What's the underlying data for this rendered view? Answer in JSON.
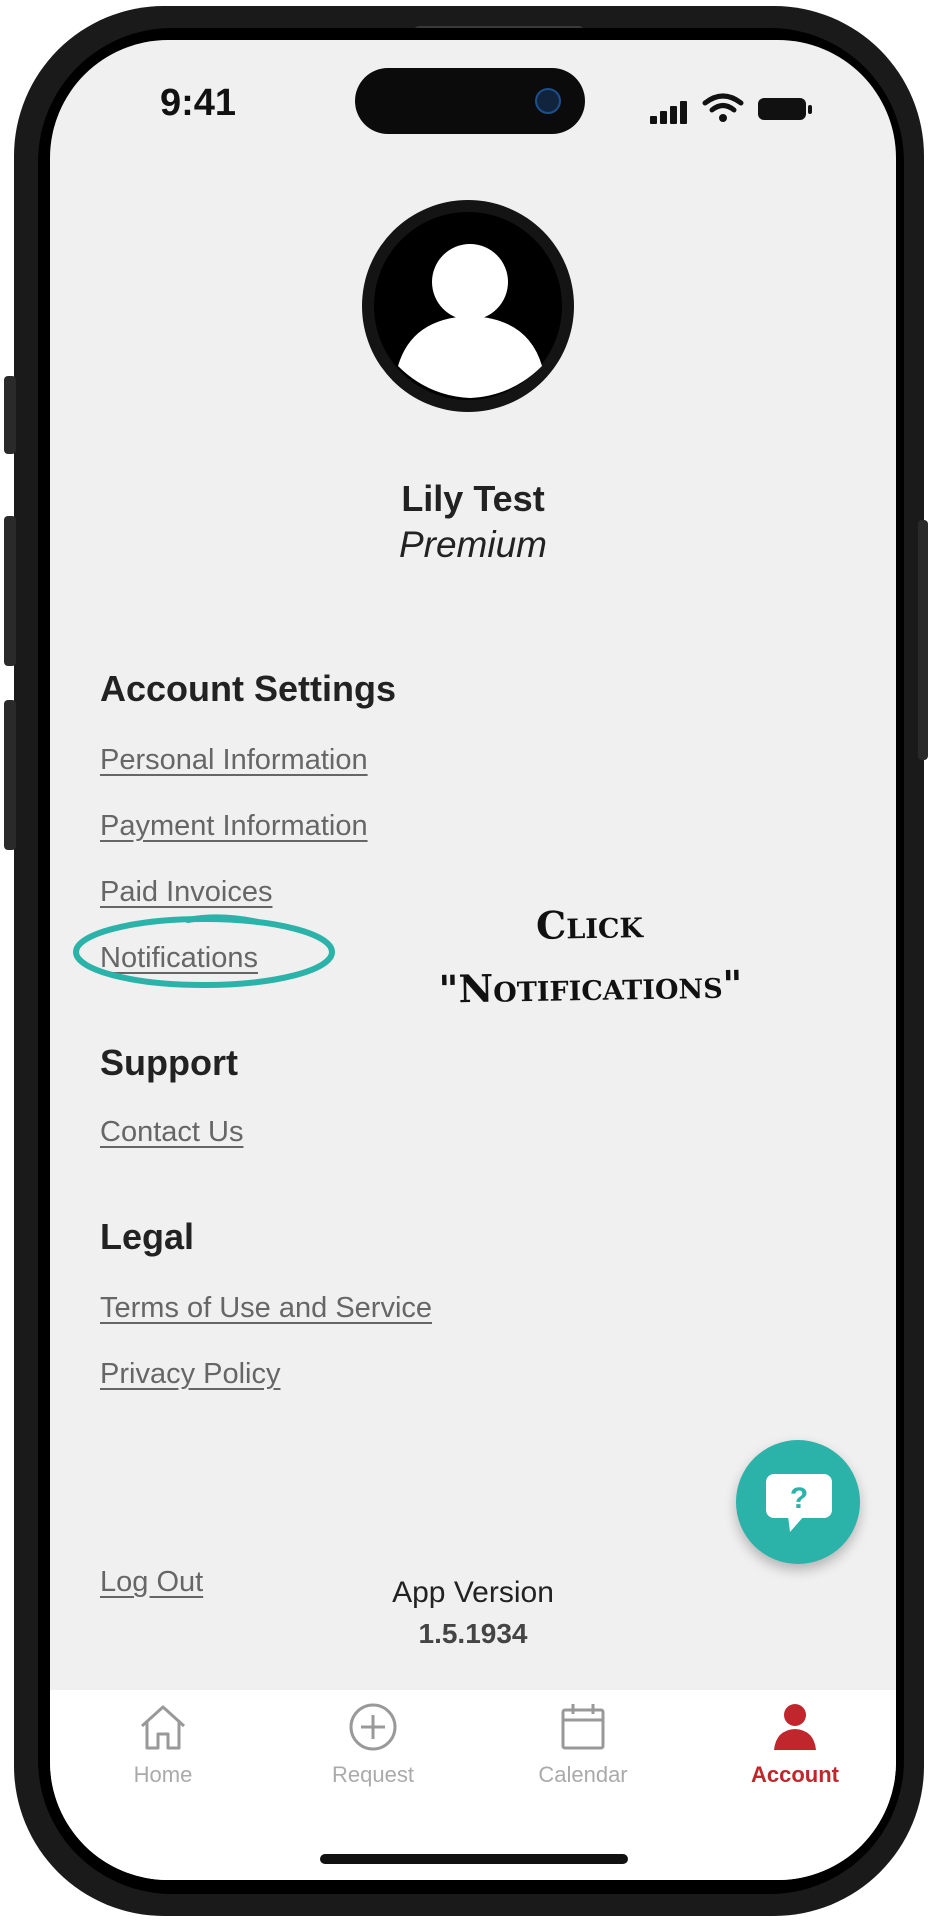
{
  "status_bar": {
    "time": "9:41"
  },
  "profile": {
    "name": "Lily Test",
    "tier": "Premium"
  },
  "account_settings": {
    "title": "Account Settings",
    "links": [
      "Personal Information",
      "Payment Information",
      "Paid Invoices",
      "Notifications"
    ]
  },
  "support": {
    "title": "Support",
    "links": [
      "Contact Us"
    ]
  },
  "legal": {
    "title": "Legal",
    "links": [
      "Terms of Use and Service",
      "Privacy Policy"
    ]
  },
  "logout": "Log Out",
  "app_version": {
    "label": "App Version",
    "number": "1.5.1934"
  },
  "annotation": {
    "line1": "Click",
    "line2": "\"Notifications\""
  },
  "help_fab": {
    "icon": "chat-question-icon",
    "symbol": "?"
  },
  "tabbar": {
    "tabs": [
      {
        "label": "Home",
        "icon": "home-icon",
        "active": false
      },
      {
        "label": "Request",
        "icon": "plus-circle-icon",
        "active": false
      },
      {
        "label": "Calendar",
        "icon": "calendar-icon",
        "active": false
      },
      {
        "label": "Account",
        "icon": "person-icon",
        "active": true
      }
    ]
  },
  "colors": {
    "accent_teal": "#2bb3a9",
    "active_red": "#c0272d",
    "background": "#f0f0f0"
  }
}
